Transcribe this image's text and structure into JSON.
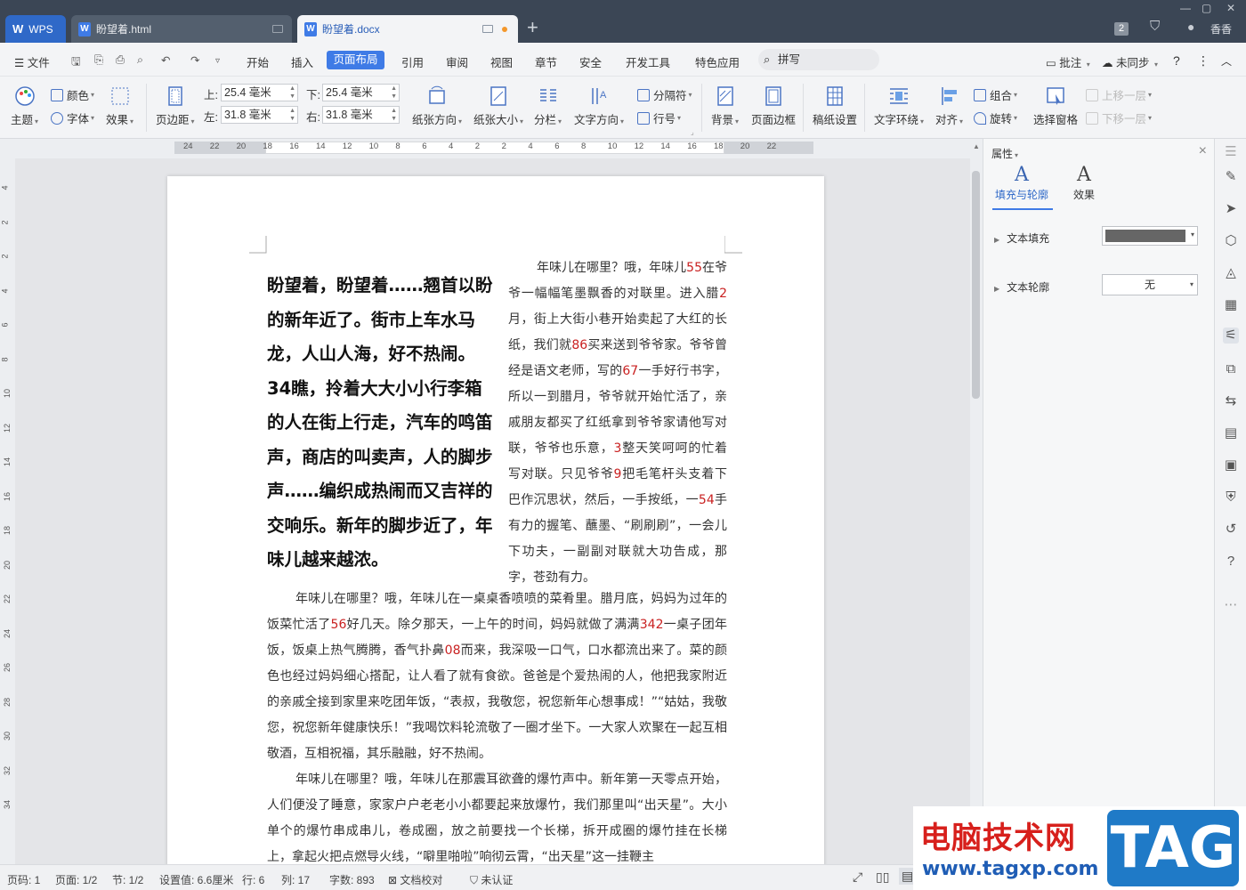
{
  "app": {
    "name": "WPS"
  },
  "tabs": [
    {
      "label": "盼望着.html"
    },
    {
      "label": "盼望着.docx"
    }
  ],
  "titlebar": {
    "badge": "2",
    "user": "香香"
  },
  "menu": {
    "file": "文件",
    "items": [
      "开始",
      "插入",
      "页面布局",
      "引用",
      "审阅",
      "视图",
      "章节",
      "安全",
      "开发工具",
      "特色应用"
    ],
    "active": "页面布局",
    "search": "拼写",
    "comment": "批注",
    "sync": "未同步"
  },
  "ribbon": {
    "theme": "主题",
    "color": "颜色",
    "font": "字体",
    "effect": "效果",
    "margins": "页边距",
    "top_label": "上:",
    "top_value": "25.4 毫米",
    "bottom_label": "下:",
    "bottom_value": "25.4 毫米",
    "left_label": "左:",
    "left_value": "31.8 毫米",
    "right_label": "右:",
    "right_value": "31.8 毫米",
    "orientation": "纸张方向",
    "size": "纸张大小",
    "columns": "分栏",
    "text_direction": "文字方向",
    "breaks": "分隔符",
    "line_numbers": "行号",
    "background": "背景",
    "page_border": "页面边框",
    "grid_paper": "稿纸设置",
    "wrap": "文字环绕",
    "align": "对齐",
    "group": "组合",
    "rotate": "旋转",
    "selection_pane": "选择窗格",
    "bring_forward": "上移一层",
    "send_backward": "下移一层"
  },
  "ruler": {
    "h_ticks": [
      "24",
      "22",
      "20",
      "18",
      "16",
      "14",
      "12",
      "10",
      "8",
      "6",
      "4",
      "2",
      "2",
      "4",
      "6",
      "8",
      "10",
      "12",
      "14",
      "16",
      "18",
      "20",
      "22"
    ],
    "v_ticks": [
      "4",
      "2",
      "2",
      "4",
      "6",
      "8",
      "10",
      "12",
      "14",
      "16",
      "18",
      "20",
      "22",
      "24",
      "26",
      "28",
      "30",
      "32",
      "34"
    ]
  },
  "document": {
    "heading": "盼望着，盼望着……翘首以盼的新年近了。街市上车水马龙，人山人海，好不热闹。34瞧，拎着大大小小行李箱的人在街上行走，汽车的鸣笛声，商店的叫卖声，人的脚步声……编织成热闹而又吉祥的交响乐。新年的脚步近了，年味儿越来越浓。",
    "right_col": [
      {
        "t": "年味儿在哪里？哦，年味儿"
      },
      {
        "t": "55",
        "red": true
      },
      {
        "t": "在爷爷一幅幅笔墨飘香的对联里。进入腊"
      },
      {
        "t": "2",
        "red": true
      },
      {
        "t": "月，街上大街小巷开始卖起了大红的长纸，我们就"
      },
      {
        "t": "86",
        "red": true
      },
      {
        "t": "买来送到爷爷家。爷爷曾经是语文老师，写的"
      },
      {
        "t": "67",
        "red": true
      },
      {
        "t": "一手好行书字，所以一到腊月，爷爷就开始忙活了，亲戚朋友都买了红纸拿到爷爷家请他写对联，爷爷也乐意，"
      },
      {
        "t": "3",
        "red": true
      },
      {
        "t": "整天笑呵呵的忙着写对联。只见爷爷"
      },
      {
        "t": "9",
        "red": true
      },
      {
        "t": "把毛笔杆头支着下巴作沉思状，然后，一手按纸，一"
      },
      {
        "t": "54",
        "red": true
      },
      {
        "t": "手有力的握笔、蘸墨、“刷刷刷”，一会儿下功夫，一副副对联就大功告成，那字，苍劲有力。"
      }
    ],
    "para2": [
      {
        "t": "年味儿在哪里？哦，年味儿在一桌桌香喷喷的菜肴里。腊月底，妈妈为过年的饭菜忙活了"
      },
      {
        "t": "56",
        "red": true
      },
      {
        "t": "好几天。除夕那天，一上午的时间，妈妈就做了满满"
      },
      {
        "t": "342",
        "red": true
      },
      {
        "t": "一桌子团年饭，饭桌上热气腾腾，香气扑鼻"
      },
      {
        "t": "08",
        "red": true
      },
      {
        "t": "而来，我深吸一口气，口水都流出来了。菜的颜色也经过妈妈细心搭配，让人看了就有食欲。爸爸是个爱热闹的人，他把我家附近的亲戚全接到家里来吃团年饭，“表叔，我敬您，祝您新年心想事成！”“姑姑，我敬您，祝您新年健康快乐！”我喝饮料轮流敬了一圈才坐下。一大家人欢聚在一起互相敬酒，互相祝福，其乐融融，好不热闹。"
      }
    ],
    "para3": "年味儿在哪里？哦，年味儿在那震耳欲聋的爆竹声中。新年第一天零点开始，人们便没了睡意，家家户户老老小小都要起来放爆竹，我们那里叫“出天星”。大小单个的爆竹串成串儿，卷成圈，放之前要找一个长梯，拆开成圈的爆竹挂在长梯上，拿起火把点燃导火线，“噼里啪啦”响彻云霄，“出天星”这一挂鞭主"
  },
  "panel": {
    "title": "属性",
    "tab_fill": "填充与轮廓",
    "tab_effect": "效果",
    "text_fill": "文本填充",
    "text_outline": "文本轮廓",
    "outline_value": "无",
    "fill_color": "#666666"
  },
  "status": {
    "page": "页码: 1",
    "pages": "页面: 1/2",
    "section": "节: 1/2",
    "position": "设置值: 6.6厘米",
    "row": "行: 6",
    "col": "列: 17",
    "words": "字数: 893",
    "proof": "文档校对",
    "cert": "未认证"
  },
  "watermark": {
    "cn": "电脑技术网",
    "url": "www.tagxp.com",
    "tag": "TAG"
  }
}
